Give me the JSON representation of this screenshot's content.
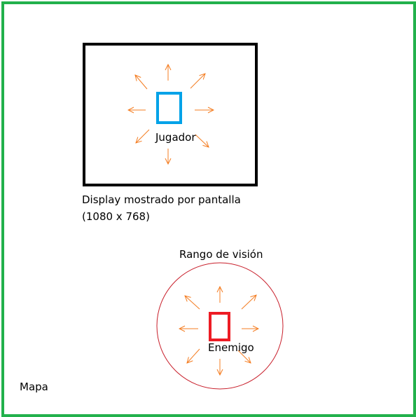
{
  "map": {
    "label": "Mapa",
    "border_color": "#22b14c"
  },
  "screen": {
    "caption_line1": "Display mostrado por pantalla",
    "caption_line2": "(1080 x 768)",
    "border_color": "#000000"
  },
  "player": {
    "label": "Jugador",
    "color": "#00a2e8",
    "arrow_color": "#f47c20"
  },
  "enemy": {
    "label": "Enemigo",
    "color": "#ed1c24",
    "arrow_color": "#f47c20",
    "vision_label": "Rango de visión",
    "vision_color": "#c81e2a"
  }
}
